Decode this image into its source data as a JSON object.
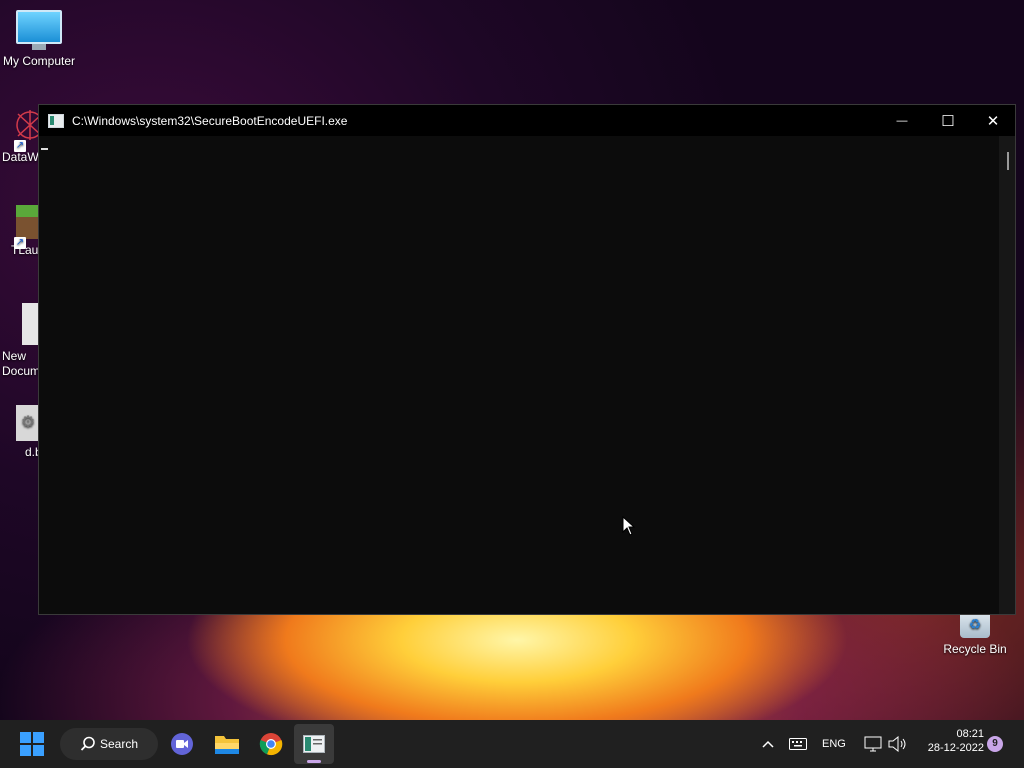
{
  "desktop": {
    "icons": [
      {
        "label": "My Computer",
        "icon": "monitor-icon"
      },
      {
        "label": "DataW",
        "icon": "datawarp-icon"
      },
      {
        "label": "TLaun",
        "icon": "minecraft-launcher-icon"
      },
      {
        "label": "New\nDocum",
        "icon": "document-icon"
      },
      {
        "label": "d.b",
        "icon": "settings-file-icon"
      },
      {
        "label": "Recycle Bin",
        "icon": "recycle-bin-icon"
      }
    ]
  },
  "window": {
    "title": "C:\\Windows\\system32\\SecureBootEncodeUEFI.exe",
    "minimize_glyph": "—",
    "maximize_glyph": "☐",
    "close_glyph": "✕"
  },
  "taskbar": {
    "search_label": "Search",
    "language": "ENG",
    "time": "08:21",
    "date": "28-12-2022",
    "notification_count": "9",
    "apps": [
      "start-icon",
      "teams-meet-icon",
      "file-explorer-icon",
      "chrome-icon",
      "console-app-icon"
    ]
  },
  "colors": {
    "console_bg": "#0c0c0c",
    "taskbar_bg": "#202020",
    "badge": "#c9a6e8"
  }
}
